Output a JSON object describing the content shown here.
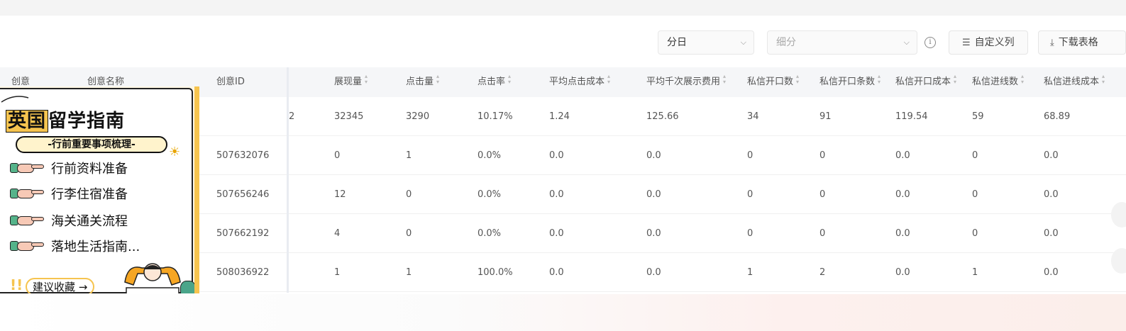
{
  "toolbar": {
    "period_select": "分日",
    "breakdown_placeholder": "细分",
    "info_icon": "ⓘ",
    "custom_columns_label": "自定义列",
    "download_label": "下载表格"
  },
  "table": {
    "headers": {
      "creative": "创意",
      "creative_name": "创意名称",
      "creative_id": "创意ID",
      "impressions": "展现量",
      "clicks": "点击量",
      "ctr": "点击率",
      "avg_cpc": "平均点击成本",
      "avg_cpm": "平均千次展示费用",
      "dm_opens": "私信开口数",
      "dm_open_msgs": "私信开口条数",
      "dm_open_cost": "私信开口成本",
      "dm_leads": "私信进线数",
      "dm_lead_cost": "私信进线成本"
    },
    "rows": [
      {
        "creative_id": "",
        "id_fragment": "2",
        "impressions": "32345",
        "clicks": "3290",
        "ctr": "10.17%",
        "avg_cpc": "1.24",
        "avg_cpm": "125.66",
        "dm_opens": "34",
        "dm_open_msgs": "91",
        "dm_open_cost": "119.54",
        "dm_leads": "59",
        "dm_lead_cost": "68.89"
      },
      {
        "creative_id": "507632076",
        "impressions": "0",
        "clicks": "1",
        "ctr": "0.0%",
        "avg_cpc": "0.0",
        "avg_cpm": "0.0",
        "dm_opens": "0",
        "dm_open_msgs": "0",
        "dm_open_cost": "0.0",
        "dm_leads": "0",
        "dm_lead_cost": "0.0"
      },
      {
        "creative_id": "507656246",
        "impressions": "12",
        "clicks": "0",
        "ctr": "0.0%",
        "avg_cpc": "0.0",
        "avg_cpm": "0.0",
        "dm_opens": "0",
        "dm_open_msgs": "0",
        "dm_open_cost": "0.0",
        "dm_leads": "0",
        "dm_lead_cost": "0.0"
      },
      {
        "creative_id": "507662192",
        "impressions": "4",
        "clicks": "0",
        "ctr": "0.0%",
        "avg_cpc": "0.0",
        "avg_cpm": "0.0",
        "dm_opens": "0",
        "dm_open_msgs": "0",
        "dm_open_cost": "0.0",
        "dm_leads": "0",
        "dm_lead_cost": "0.0"
      },
      {
        "creative_id": "508036922",
        "impressions": "1",
        "clicks": "1",
        "ctr": "100.0%",
        "avg_cpc": "0.0",
        "avg_cpm": "0.0",
        "dm_opens": "1",
        "dm_open_msgs": "2",
        "dm_open_cost": "0.0",
        "dm_leads": "1",
        "dm_lead_cost": "0.0"
      }
    ]
  },
  "poster": {
    "title_part1": "英国",
    "title_part2": "留学指南",
    "subtitle": "-行前重要事项梳理-",
    "items": [
      "行前资料准备",
      "行李住宿准备",
      "海关通关流程",
      "落地生活指南..."
    ],
    "cta": "建议收藏 →"
  },
  "colors": {
    "header_bg": "#f5f6f8",
    "poster_accent": "#f6c44f"
  }
}
